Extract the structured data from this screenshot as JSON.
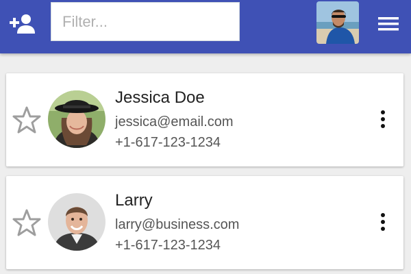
{
  "toolbar": {
    "background": "#3f51b5",
    "add_icon": "person-add-icon",
    "filter_placeholder": "Filter...",
    "filter_value": "",
    "menu_icon": "hamburger-menu-icon"
  },
  "contacts": [
    {
      "name": "Jessica Doe",
      "email": "jessica@email.com",
      "phone": "+1-617-123-1234",
      "starred": false
    },
    {
      "name": "Larry",
      "email": "larry@business.com",
      "phone": "+1-617-123-1234",
      "starred": false
    }
  ]
}
